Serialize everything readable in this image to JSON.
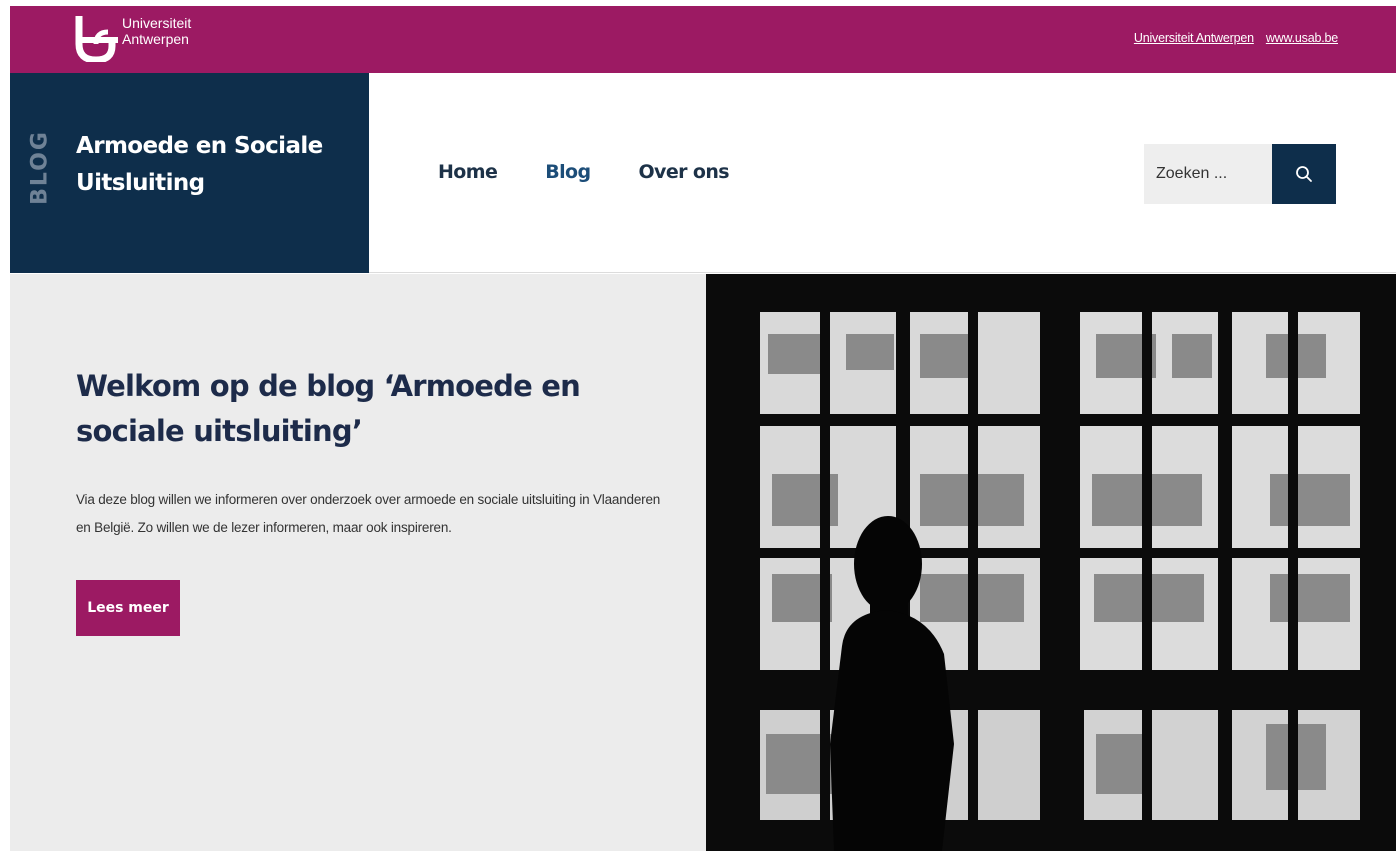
{
  "topbar": {
    "logo_line1": "Universiteit",
    "logo_line2": "Antwerpen",
    "links": [
      "Universiteit Antwerpen",
      "www.usab.be"
    ]
  },
  "brand": {
    "tag": "BLOG",
    "title": "Armoede en Sociale Uitsluiting"
  },
  "nav": {
    "items": [
      "Home",
      "Blog",
      "Over ons"
    ],
    "active": "Blog"
  },
  "search": {
    "placeholder": "Zoeken ..."
  },
  "hero": {
    "title": "Welkom op de blog ‘Armoede en sociale uitsluiting’",
    "text": "Via deze blog willen we informeren over onderzoek over armoede en sociale uitsluiting in Vlaanderen en België. Zo willen we de lezer informeren, maar ook inspireren.",
    "button_label": "Lees meer"
  },
  "colors": {
    "brand_magenta": "#9c1a63",
    "brand_navy": "#0e2e4b",
    "hero_bg": "#ececec"
  }
}
